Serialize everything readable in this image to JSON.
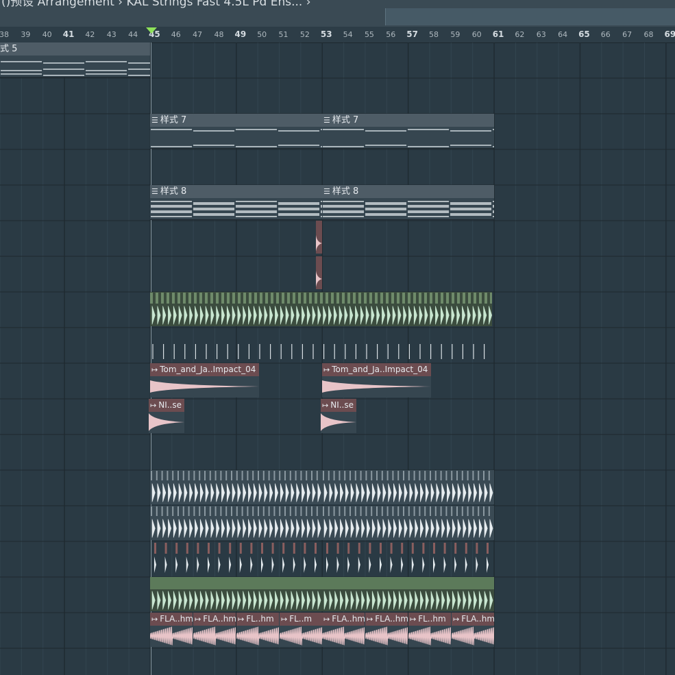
{
  "window": {
    "title": "()预设  Arrangement  ›  KAL Strings Fast 4.5L Pd Ens... ›"
  },
  "ruler": {
    "bars": [
      "38",
      "39",
      "40",
      "41",
      "42",
      "43",
      "44",
      "45",
      "46",
      "47",
      "48",
      "49",
      "50",
      "51",
      "52",
      "53",
      "54",
      "55",
      "56",
      "57",
      "58",
      "59",
      "60",
      "61",
      "62",
      "63",
      "64",
      "65",
      "66",
      "67",
      "68",
      "69"
    ],
    "major_bars": [
      "41",
      "45",
      "49",
      "53",
      "57",
      "61",
      "65",
      "69"
    ],
    "playhead_bar": 45
  },
  "clips": {
    "pattern5": "式 5",
    "pattern7": "样式 7",
    "pattern8": "样式 8",
    "impact": "Tom_and_Ja..Impact_04",
    "noise": "NI..se",
    "fla_a": "FLA..hm",
    "fla_b": "FL..hm",
    "fla_c": "FL..m"
  },
  "icons": {
    "pattern": "pattern-clip-icon",
    "audio": "audio-clip-icon"
  },
  "colors": {
    "background": "#2a3a44",
    "grid_line": "#3d4f5a",
    "pattern_header": "#4e5c66",
    "audio_header": "#6c4c50",
    "audio_wave_green": "#c8e6d0",
    "audio_wave_pink": "#e8c4c8",
    "playhead": "#8ee25a"
  }
}
